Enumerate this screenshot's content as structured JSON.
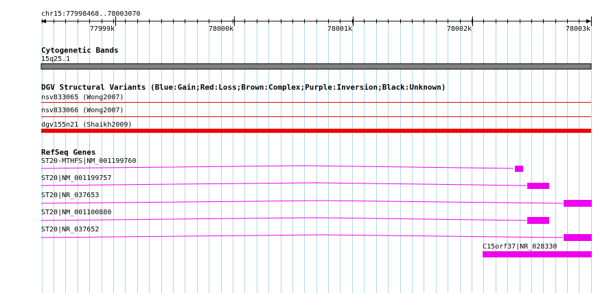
{
  "ruler": {
    "locus": "chr15:77998468..78003070",
    "ticks": [
      "77999k",
      "78000k",
      "78001k",
      "78002k",
      "78003k"
    ]
  },
  "cytoband": {
    "title": "Cytogenetic Bands",
    "band_label": "15q25.1",
    "color": "#808080"
  },
  "dgv": {
    "title": "DGV Structural Variants (Blue:Gain;Red:Loss;Brown:Complex;Purple:Inversion;Black:Unknown)",
    "features": [
      {
        "label": "nsv833065 (Wong2007)",
        "color": "#e00000"
      },
      {
        "label": "nsv833066 (Wong2007)",
        "color": "#e00000"
      },
      {
        "label": "dgv155n21 (Shaikh2009)",
        "color": "#ee0000"
      }
    ]
  },
  "refseq": {
    "title": "RefSeq Genes",
    "color": "#ee00ee",
    "genes": [
      {
        "label": "ST20-MTHFS|NM_001199760"
      },
      {
        "label": "ST20|NM_001199757"
      },
      {
        "label": "ST20|NR_037653"
      },
      {
        "label": "ST20|NM_001100880"
      },
      {
        "label": "ST20|NR_037652"
      },
      {
        "label": "C15orf37|NR_028330"
      }
    ]
  },
  "colors": {
    "grid": "#add8e6",
    "ruler": "#000000"
  }
}
